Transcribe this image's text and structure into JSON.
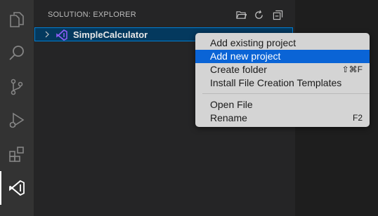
{
  "activity_bar": {
    "items": [
      {
        "icon": "files-icon"
      },
      {
        "icon": "search-icon"
      },
      {
        "icon": "source-control-icon"
      },
      {
        "icon": "run-debug-icon"
      },
      {
        "icon": "extensions-icon"
      },
      {
        "icon": "solution-explorer-icon",
        "active": true
      }
    ]
  },
  "sidebar": {
    "title": "SOLUTION: EXPLORER",
    "actions": [
      "open-folder-icon",
      "refresh-icon",
      "collapse-all-icon"
    ],
    "tree": {
      "item_label": "SimpleCalculator",
      "item_icon": "visual-studio-icon"
    }
  },
  "context_menu": {
    "items": [
      {
        "label": "Add existing project",
        "shortcut": ""
      },
      {
        "label": "Add new project",
        "shortcut": "",
        "highlighted": true
      },
      {
        "label": "Create folder",
        "shortcut": "⇧⌘F"
      },
      {
        "label": "Install File Creation Templates",
        "shortcut": ""
      },
      {
        "label": "Open File",
        "shortcut": ""
      },
      {
        "label": "Rename",
        "shortcut": "F2"
      }
    ]
  },
  "colors": {
    "accent": "#0a64d6",
    "selection_border": "#007fd4",
    "vs_purple": "#8a5cf5"
  }
}
